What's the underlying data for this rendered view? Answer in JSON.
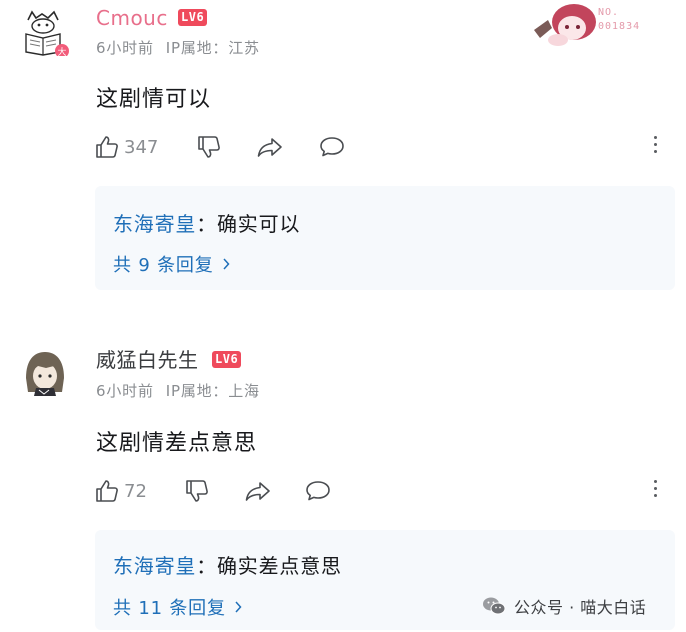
{
  "comments": [
    {
      "username": "Cmouc",
      "level": "LV6",
      "time": "6小时前",
      "ip": "IP属地：江苏",
      "content": "这剧情可以",
      "likes": "347",
      "reply": {
        "name": "东海寄皇",
        "text": "：确实可以",
        "more": "共 9 条回复"
      },
      "sticker_label": [
        "NO.",
        "001834"
      ]
    },
    {
      "username": "威猛白先生",
      "level": "LV6",
      "time": "6小时前",
      "ip": "IP属地：上海",
      "content": "这剧情差点意思",
      "likes": "72",
      "reply": {
        "name": "东海寄皇",
        "text": "：确实差点意思",
        "more": "共 11 条回复"
      }
    }
  ],
  "watermark": "公众号 · 喵大白话",
  "colors": {
    "accent": "#1f6fb8",
    "username_pink": "#e86f8b",
    "level_badge": "#ef4a5c",
    "meta_grey": "#8a8d91",
    "reply_bg": "#f6f9fc"
  }
}
